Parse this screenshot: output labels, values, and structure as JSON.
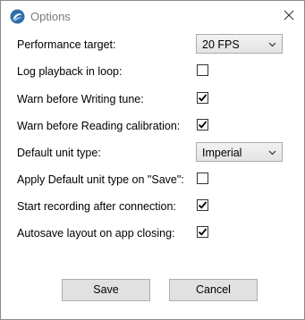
{
  "window": {
    "title": "Options"
  },
  "options": {
    "performance_target": {
      "label": "Performance target:",
      "value": "20 FPS"
    },
    "log_playback_loop": {
      "label": "Log playback in loop:",
      "checked": false
    },
    "warn_writing_tune": {
      "label": "Warn before Writing tune:",
      "checked": true
    },
    "warn_reading_calibration": {
      "label": "Warn before Reading calibration:",
      "checked": true
    },
    "default_unit_type": {
      "label": "Default unit type:",
      "value": "Imperial"
    },
    "apply_unit_on_save": {
      "label": "Apply Default unit type on \"Save\":",
      "checked": false
    },
    "start_recording": {
      "label": "Start recording after connection:",
      "checked": true
    },
    "autosave_layout": {
      "label": "Autosave layout on app closing:",
      "checked": true
    }
  },
  "buttons": {
    "save": "Save",
    "cancel": "Cancel"
  },
  "icons": {
    "app": "app-logo-icon",
    "close": "close-icon",
    "dropdown": "chevron-down-icon",
    "check": "checkmark-icon"
  },
  "colors": {
    "dropdown_bg": "#e8e8e8",
    "button_bg": "#e1e1e1",
    "border": "#acacac"
  }
}
